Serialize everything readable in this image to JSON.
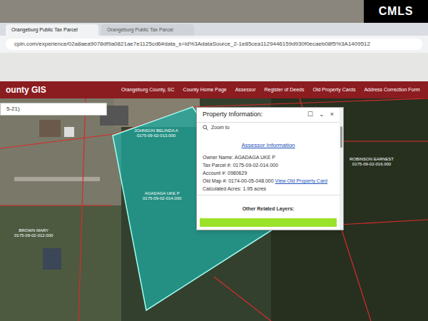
{
  "logo": "CMLS",
  "browser": {
    "tabs": [
      {
        "label": "Orangeburg Public Tax Parcel",
        "selected": true
      },
      {
        "label": "Orangeburg Public Tax Parcel",
        "selected": false
      }
    ],
    "url": "cpln.com/experience/02a8aea9078df9a0821ae7e1125cd6#data_s=id%3AdataSource_2-1e85cea1129446159d930f0ecaeb08f5%3A1409512"
  },
  "header": {
    "title": "ounty GIS",
    "nav": [
      "Orangeburg County, SC",
      "County Home Page",
      "Assessor",
      "Register of Deeds",
      "Old Property Cards",
      "Address Correction Form"
    ]
  },
  "search": {
    "value": "5-21)"
  },
  "popup": {
    "title": "Property Information:",
    "icons": [
      "☐",
      "⌄",
      "×"
    ],
    "zoom": "Zoom to",
    "section": "Assessor Information",
    "fields": [
      {
        "label": "Owner Name:",
        "value": "AGADAGA UKE P"
      },
      {
        "label": "Tax Parcel #:",
        "value": "0175-09-02-014.000"
      },
      {
        "label": "Account #:",
        "value": "0980629"
      },
      {
        "label": "Old Map #:",
        "value": "0174-00-05-048.000"
      },
      {
        "label": "Calculated Acres:",
        "value": "1.95 acres"
      }
    ],
    "link": "View Old Property Card",
    "related": "Other Related Layers:"
  },
  "map_labels": [
    {
      "name": "JOHNSON BELINDA A",
      "parcel": "0175-09-02-013.000"
    },
    {
      "name": "AGADAGA UKE P",
      "parcel": "0175-09-02-014.000"
    },
    {
      "name": "ROBINSON EARNEST",
      "parcel": "0175-09-02-016.000"
    },
    {
      "name": "BROWN MARY",
      "parcel": "0175-09-02-012.000"
    }
  ]
}
